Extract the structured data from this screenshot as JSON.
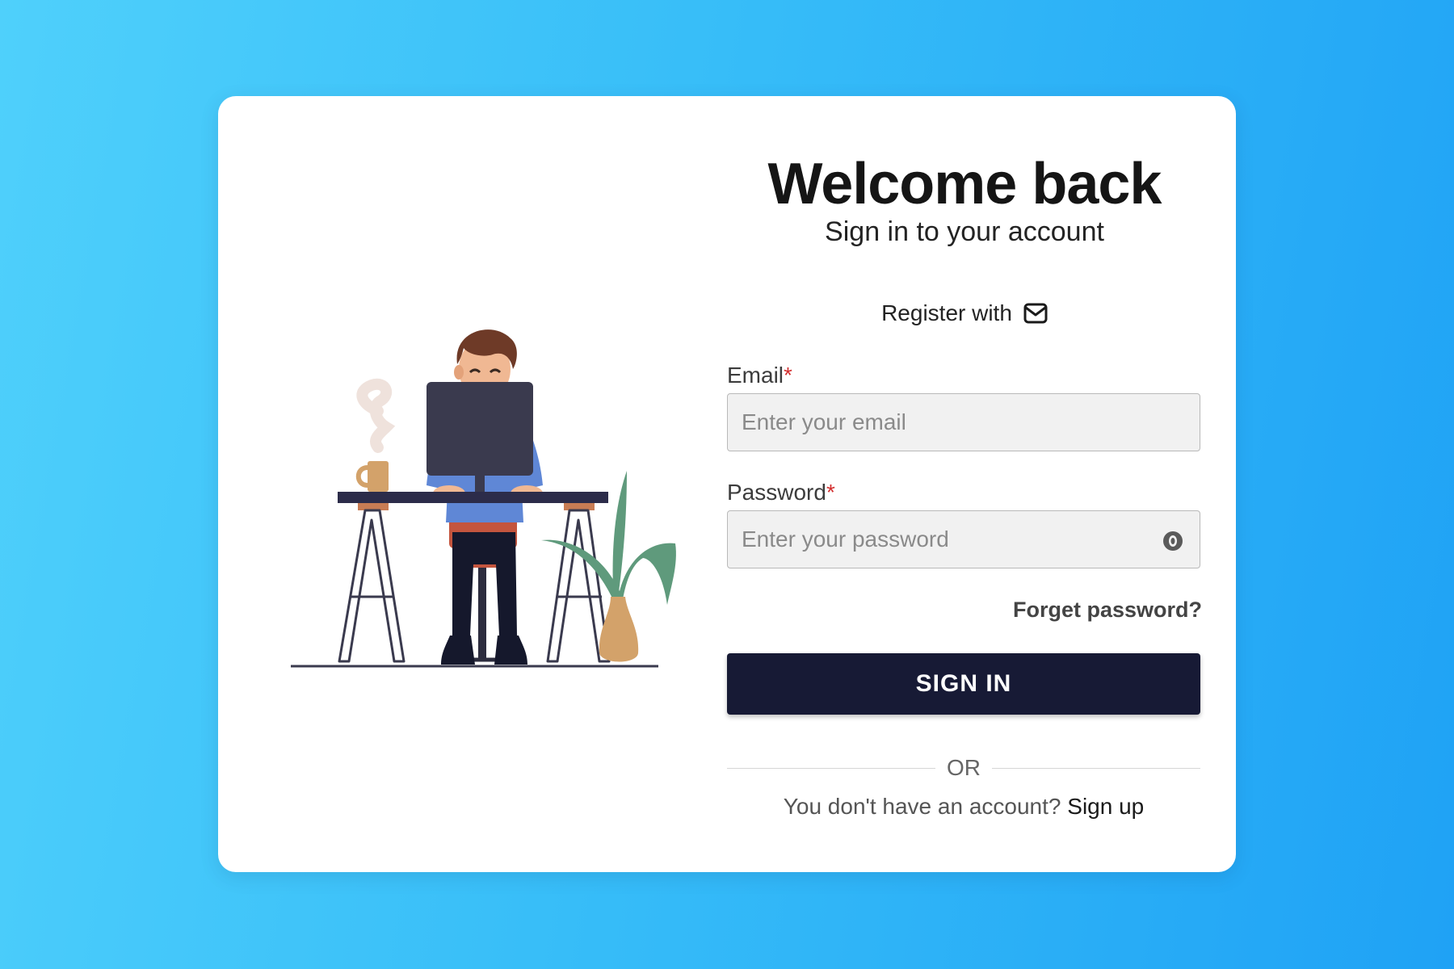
{
  "login": {
    "title": "Welcome back",
    "subtitle": "Sign in to your account",
    "register_label": "Register with",
    "register_icon": "mail-icon",
    "email": {
      "label": "Email",
      "required_mark": "*",
      "placeholder": "Enter your email",
      "value": ""
    },
    "password": {
      "label": "Password",
      "required_mark": "*",
      "placeholder": "Enter your password",
      "value": "",
      "toggle_icon": "eye-icon"
    },
    "forgot_label": "Forget password?",
    "signin_label": "SIGN IN",
    "or_label": "OR",
    "no_account_text": "You don't have an account?",
    "signup_label": "Sign up"
  },
  "colors": {
    "background_start": "#4fd0fb",
    "background_end": "#1fa2f5",
    "button": "#171a35",
    "required": "#d32f2f"
  }
}
